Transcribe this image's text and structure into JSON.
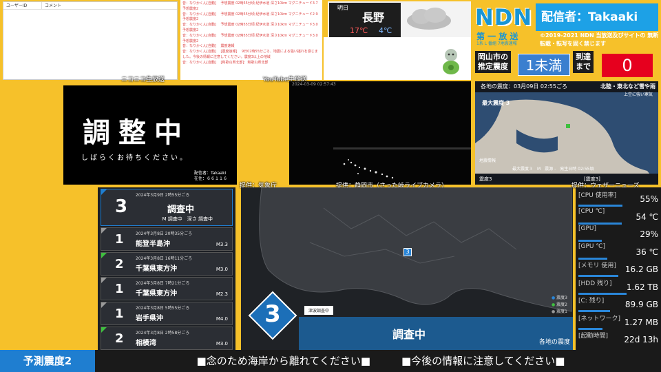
{
  "comments": {
    "col_user": "ユーザーID",
    "col_comment": "コメント",
    "source_label": "ニコニコ生放送"
  },
  "youtube": {
    "source_label": "YouTube生放送",
    "lines": [
      "音：なりかくん[自動]　 予想震度 02時55分頃 紀伊水道 深さ10km マグニチュード3.7 予想震度2",
      "音：なりかくん[自動]　 予想震度 02時55分頃 紀伊水道 深さ10km マグニチュード2.9 予想震度2",
      "音：なりかくん[自動]　 予想震度 02時55分頃 紀伊水道 深さ10km マグニチュード3.0 予想震度2",
      "音：なりかくん[自動]　 予想震度 02時55分頃 紀伊水道 深さ10km マグニチュード3.0 予想震度2",
      "音：なりかくん[自動]　 震度速報",
      "音：なりかくん[自動]　 [震度速報]　 9日02時55分ごろ、地震による強い揺れを感じました。今後の情報に注意してください。震度3以上の地域",
      "音：なりかくん[自動]　 [和歌山県北部]：和歌山県北部"
    ]
  },
  "weather": {
    "label": "明日",
    "city": "長野",
    "high": "17℃",
    "low": "4℃"
  },
  "header": {
    "logo": "NDN",
    "streamer": "配信者：Takaaki",
    "subtitle": "第 一 放 送",
    "subtitle_small": "1系 L 番組 7地震速報",
    "copyright": "©2019-2021 NDN 当放送及びサイトの 無断転載・転写を固く禁じます",
    "pref_label_1": "岡山市の",
    "pref_label_2": "推定震度",
    "pref_value": "1未満",
    "arrival_label_1": "到達",
    "arrival_label_2": "まで",
    "arrival_value": "0"
  },
  "adjust": {
    "title": "調整中",
    "message": "しばらくお待ちください。",
    "info_1": "配信者：Takaaki",
    "info_2": "在住：６６１１６"
  },
  "livecam": {
    "timestamp": "2024-03-09 02:57:43",
    "source_label": "提供：静岡市（さった峠ライブカメラ）"
  },
  "eqmap_top": {
    "header": "各地の震度：03月09日 02:55ごろ",
    "region": "北陸・東北など雪や雨",
    "region_sub": "上空に強い寒気",
    "max_label": "最大震度 3",
    "info_label": "地震情報",
    "info_line": "最大震度３　M　震源 -　発生日時 02:55頃",
    "footer": "震度3",
    "footer_right": "[震度3]",
    "source_label": "提供：ウェザーニューズ"
  },
  "main_source_label": "提供：気象庁",
  "eq_list": [
    {
      "intensity": "3",
      "time": "2024年3月9日 2時55分ごろ",
      "place": "調査中",
      "mag": "M 調査中　深さ 調査中",
      "color": "#1f7ed0"
    },
    {
      "intensity": "1",
      "time": "2024年3月8日 20時35分ごろ",
      "place": "能登半島沖",
      "mag": "M3.3",
      "color": "#9a9a9a"
    },
    {
      "intensity": "2",
      "time": "2024年3月8日 16時11分ごろ",
      "place": "千葉県東方沖",
      "mag": "M3.0",
      "color": "#3fbf3f"
    },
    {
      "intensity": "1",
      "time": "2024年3月8日 7時21分ごろ",
      "place": "千葉県東方沖",
      "mag": "M2.3",
      "color": "#9a9a9a"
    },
    {
      "intensity": "1",
      "time": "2024年3月8日 5時55分ごろ",
      "place": "岩手県沖",
      "mag": "M4.0",
      "color": "#9a9a9a"
    },
    {
      "intensity": "2",
      "time": "2024年3月8日 2時58分ごろ",
      "place": "相模湾",
      "mag": "M3.0",
      "color": "#3fbf3f"
    }
  ],
  "main_map": {
    "shindo": "3",
    "tsunami": "津波調査中",
    "status": "調査中",
    "legend": [
      "震度3",
      "震度2",
      "震度1"
    ],
    "legend_colors": [
      "#2a86d8",
      "#3fbf3f",
      "#9a9a9a"
    ],
    "footer": "各地の震度",
    "marker": "3"
  },
  "stats": [
    {
      "key": "[CPU 使用率]",
      "value": "55%",
      "level": 0.55
    },
    {
      "key": "[CPU ℃]",
      "value": "54 ℃",
      "level": 0.54
    },
    {
      "key": "[GPU]",
      "value": "29%",
      "level": 0.29
    },
    {
      "key": "[GPU ℃]",
      "value": "36 ℃",
      "level": 0.36
    },
    {
      "key": "[メモリ 使用]",
      "value": "16.2 GB",
      "level": 0.5
    },
    {
      "key": "[HDD 残り]",
      "value": "1.62 TB",
      "level": 0.6
    },
    {
      "key": "[C: 残り]",
      "value": "89.9 GB",
      "level": 0.4
    },
    {
      "key": "[ネットワーク]",
      "value": "1.27 MB",
      "level": 0.3
    },
    {
      "key": "[起動時間]",
      "value": "22d 13h",
      "level": 0
    }
  ],
  "bottom": {
    "prediction": "予測震度2",
    "message": "■念のため海岸から離れてください■　　　■今後の情報に注意してください■"
  }
}
